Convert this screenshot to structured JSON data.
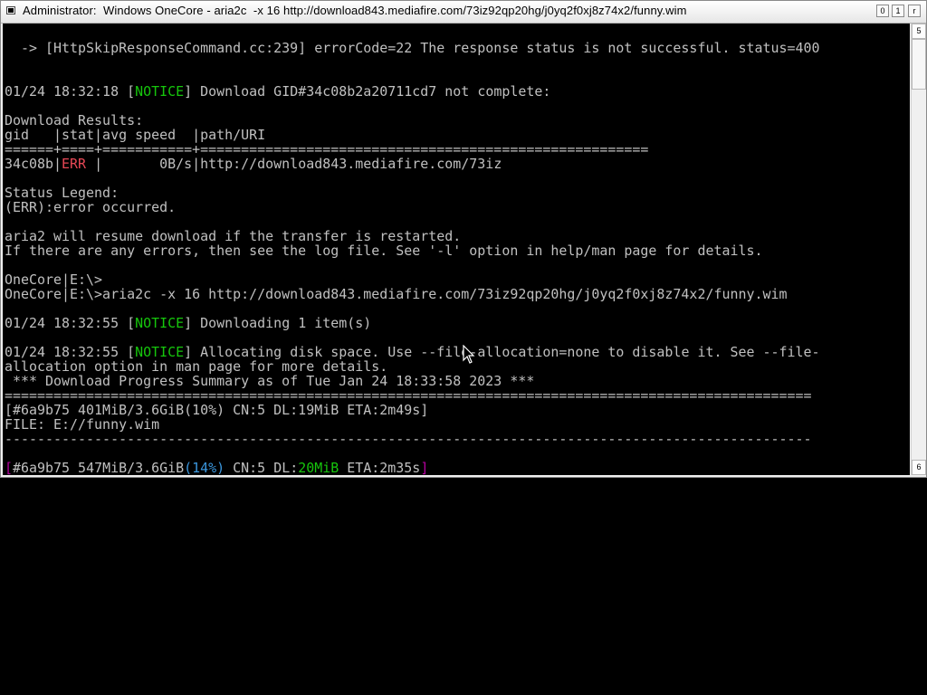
{
  "window": {
    "title": "Administrator:  Windows OneCore - aria2c  -x 16 http://download843.mediafire.com/73iz92qp20hg/j0yq2f0xj8z74x2/funny.wim",
    "buttons": {
      "minimize": "0",
      "maximize": "1",
      "close": "r"
    }
  },
  "terminal": {
    "l1": "  -> [HttpSkipResponseCommand.cc:239] errorCode=22 The response status is not successful. status=400",
    "l3_ts": "01/24 18:32:18 [",
    "l3_tag": "NOTICE",
    "l3_rest": "] Download GID#34c08b2a20711cd7 not complete:",
    "l5": "Download Results:",
    "l6": "gid   |stat|avg speed  |path/URI",
    "l7": "======+====+===========+=======================================================",
    "l8_gid": "34c08b|",
    "l8_stat": "ERR ",
    "l8_rest": "|       0B/s|http://download843.mediafire.com/73iz",
    "l10": "Status Legend:",
    "l11": "(ERR):error occurred.",
    "l13": "aria2 will resume download if the transfer is restarted.",
    "l14": "If there are any errors, then see the log file. See '-l' option in help/man page for details.",
    "l16": "OneCore|E:\\>",
    "l17": "OneCore|E:\\>aria2c -x 16 http://download843.mediafire.com/73iz92qp20hg/j0yq2f0xj8z74x2/funny.wim",
    "l19_ts": "01/24 18:32:55 [",
    "l19_tag": "NOTICE",
    "l19_rest": "] Downloading 1 item(s)",
    "l21_ts": "01/24 18:32:55 [",
    "l21_tag": "NOTICE",
    "l21_rest": "] Allocating disk space. Use --file-allocation=none to disable it. See --file-",
    "l22": "allocation option in man page for more details.",
    "l23": " *** Download Progress Summary as of Tue Jan 24 18:33:58 2023 ***",
    "l24": "===================================================================================================",
    "l25": "[#6a9b75 401MiB/3.6GiB(10%) CN:5 DL:19MiB ETA:2m49s]",
    "l26": "FILE: E://funny.wim",
    "l27": "---------------------------------------------------------------------------------------------------",
    "l29_open": "[",
    "l29_a": "#6a9b75 547MiB/3.6GiB",
    "l29_pct": "(14%)",
    "l29_b": " CN:5 DL:",
    "l29_speed": "20MiB",
    "l29_c": " ETA:2m35s",
    "l29_close": "]"
  },
  "scrollbar": {
    "up": "5",
    "down": "6"
  },
  "colors": {
    "background": "#000000",
    "text": "#c0c0c0",
    "notice": "#16c60c",
    "error": "#e74856",
    "percent": "#3a96dd",
    "bracket": "#b4009e"
  }
}
